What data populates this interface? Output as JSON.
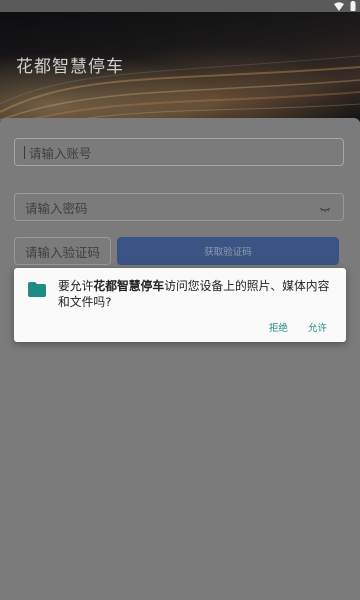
{
  "status_bar": {
    "icons": [
      "wifi-icon",
      "battery-icon"
    ]
  },
  "header": {
    "title": "花都智慧停车"
  },
  "login_form": {
    "account_placeholder": "请输入账号",
    "password_placeholder": "请输入密码",
    "code_placeholder": "请输入验证码",
    "get_code_label": "获取验证码"
  },
  "permission_dialog": {
    "message_prefix": "要允许",
    "app_name": "花都智慧停车",
    "message_suffix": "访问您设备上的照片、媒体内容和文件吗?",
    "deny_label": "拒绝",
    "allow_label": "允许",
    "icon": "folder-icon"
  },
  "colors": {
    "dialog_accent": "#1e8c84",
    "primary_button": "#3a5584",
    "scrim": "#7b7b7b"
  }
}
